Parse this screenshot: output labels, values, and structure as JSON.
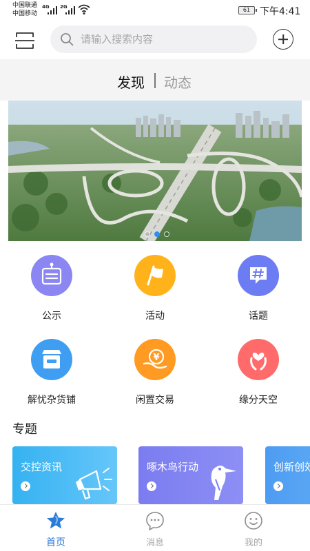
{
  "status_bar": {
    "carrier_1": "中国联通",
    "carrier_2": "中国移动",
    "net_1": "4G",
    "net_2": "2G",
    "battery": "61",
    "time": "下午4:41"
  },
  "header": {
    "search_placeholder": "请输入搜索内容",
    "scan_icon": "scan-frame-icon",
    "add_icon": "plus-circle-icon"
  },
  "tabs": [
    {
      "label": "发现",
      "active": true
    },
    {
      "label": "动态",
      "active": false
    }
  ],
  "banner": {
    "image": "aerial-highway-interchange",
    "page_count": 3,
    "active_index": 1
  },
  "grid": [
    {
      "label": "公示",
      "icon": "notice-board-icon",
      "color": "#8b86f2"
    },
    {
      "label": "活动",
      "icon": "flag-icon",
      "color": "#ffb21a"
    },
    {
      "label": "话题",
      "icon": "hashtag-icon",
      "color": "#6c7cf3"
    },
    {
      "label": "解忧杂货铺",
      "icon": "store-icon",
      "color": "#3f9ef2"
    },
    {
      "label": "闲置交易",
      "icon": "yen-coin-icon",
      "color": "#ff9a22"
    },
    {
      "label": "缘分天空",
      "icon": "heart-hands-icon",
      "color": "#ff6b6b"
    }
  ],
  "section": {
    "title": "专题"
  },
  "topic_cards": [
    {
      "title": "交控资讯",
      "icon": "megaphone-icon"
    },
    {
      "title": "啄木鸟行动",
      "icon": "woodpecker-icon"
    },
    {
      "title": "创新创效",
      "icon": ""
    }
  ],
  "bottom_nav": [
    {
      "label": "首页",
      "icon": "star-home-icon",
      "active": true
    },
    {
      "label": "消息",
      "icon": "message-bubble-icon",
      "active": false
    },
    {
      "label": "我的",
      "icon": "smile-face-icon",
      "active": false
    }
  ],
  "colors": {
    "accent": "#2b7bd8",
    "inactive": "#a6a6a6"
  }
}
